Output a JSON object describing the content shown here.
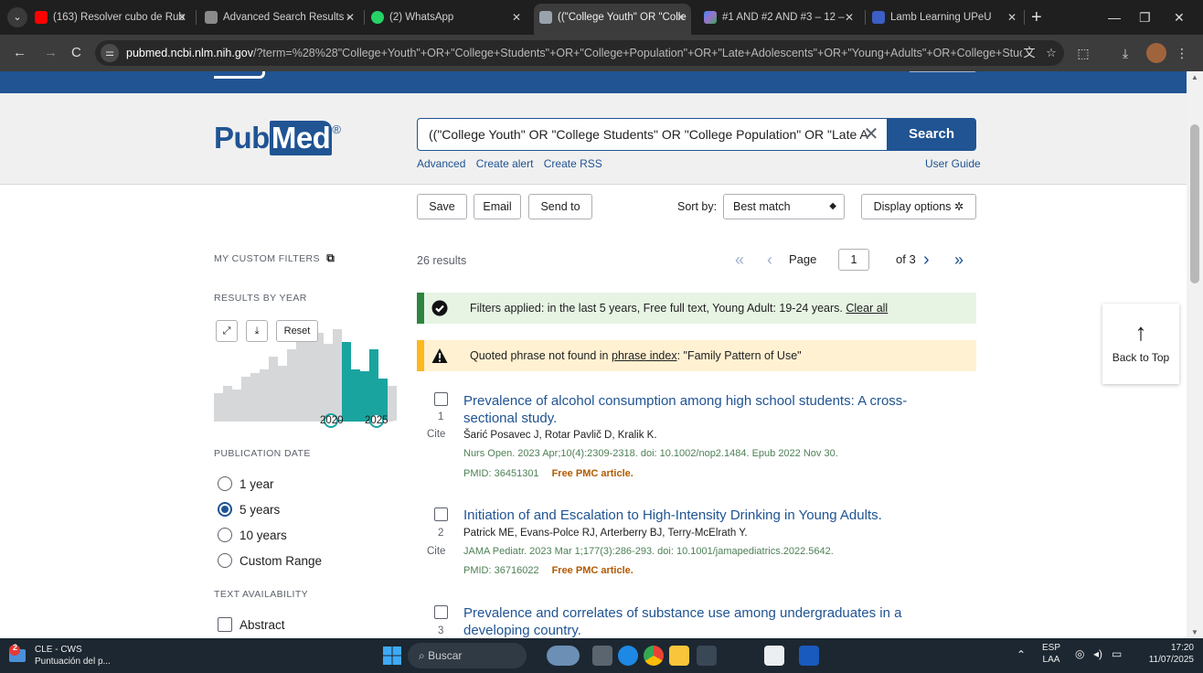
{
  "browser": {
    "tabs": [
      {
        "label": "(163) Resolver cubo de Rub",
        "icon": "youtube-icon"
      },
      {
        "label": "Advanced Search Results -",
        "icon": "pubmed-icon"
      },
      {
        "label": "(2) WhatsApp",
        "icon": "whatsapp-icon"
      },
      {
        "label": "((\"College Youth\" OR \"Colle",
        "icon": "pubmed-icon"
      },
      {
        "label": "#1 AND #2 AND #3 – 12 –",
        "icon": "gemini-icon"
      },
      {
        "label": "Lamb Learning UPeU",
        "icon": "lamb-icon"
      }
    ],
    "url_host": "pubmed.ncbi.nlm.nih.gov",
    "url_path": "/?term=%28%28\"College+Youth\"+OR+\"College+Students\"+OR+\"College+Population\"+OR+\"Late+Adolescents\"+OR+\"Young+Adults\"+OR+College+Stude..."
  },
  "search": {
    "logo_pub": "Pub",
    "logo_med": "Med",
    "logo_reg": "®",
    "query": "((\"College Youth\" OR \"College Students\" OR \"College Population\" OR \"Late A",
    "clear_symbol": "✕",
    "button": "Search",
    "links": [
      "Advanced",
      "Create alert",
      "Create RSS"
    ],
    "user_guide": "User Guide"
  },
  "actions": {
    "save": "Save",
    "email": "Email",
    "send_to": "Send to",
    "sort_by_label": "Sort by:",
    "sort_value": "Best match",
    "display_options": "Display options"
  },
  "sidebar": {
    "custom_filters": "MY CUSTOM FILTERS",
    "results_by_year": "RESULTS BY YEAR",
    "reset": "Reset",
    "year_start": "2020",
    "year_end": "2025",
    "publication_date": "PUBLICATION DATE",
    "date_options": [
      {
        "label": "1 year",
        "selected": false
      },
      {
        "label": "5 years",
        "selected": true
      },
      {
        "label": "10 years",
        "selected": false
      },
      {
        "label": "Custom Range",
        "selected": false
      }
    ],
    "text_availability": "TEXT AVAILABILITY",
    "abstract": "Abstract"
  },
  "results": {
    "count": "26 results",
    "page_label": "Page",
    "page_current": "1",
    "page_of": "of 3",
    "filter_alert_text": "Filters applied: in the last 5 years, Free full text, Young Adult: 19-24 years.",
    "filter_alert_link": "Clear all",
    "warning_prefix": "Quoted phrase not found in",
    "warning_link": "phrase index",
    "warning_suffix": ": \"Family Pattern of Use\"",
    "cite_label": "Cite",
    "items": [
      {
        "num": "1",
        "title": "Prevalence of alcohol consumption among high school students: A cross-sectional study.",
        "authors": "Šarić Posavec J, Rotar Pavlič D, Kralik K.",
        "citation": "Nurs Open. 2023 Apr;10(4):2309-2318. doi: 10.1002/nop2.1484. Epub 2022 Nov 30.",
        "pmid": "PMID: 36451301",
        "pmc": "Free PMC article."
      },
      {
        "num": "2",
        "title": "Initiation of and Escalation to High-Intensity Drinking in Young Adults.",
        "authors": "Patrick ME, Evans-Polce RJ, Arterberry BJ, Terry-McElrath Y.",
        "citation": "JAMA Pediatr. 2023 Mar 1;177(3):286-293. doi: 10.1001/jamapediatrics.2022.5642.",
        "pmid": "PMID: 36716022",
        "pmc": "Free PMC article."
      },
      {
        "num": "3",
        "title": "Prevalence and correlates of substance use among undergraduates in a developing country."
      }
    ]
  },
  "back_to_top": "Back to Top",
  "taskbar": {
    "app_title": "CLE - CWS",
    "app_subtitle": "Puntuación del p...",
    "app_badge": "2",
    "search_placeholder": "Buscar",
    "lang": "ESP",
    "lang2": "LAA",
    "time": "17:20",
    "date": "11/07/2025"
  },
  "colors": {
    "pubmed_blue": "#205493",
    "success_green": "#2e8540",
    "warning_yellow": "#fdb81e",
    "chart_teal": "#1aa4a0",
    "chart_gray": "#d6d7d9"
  }
}
